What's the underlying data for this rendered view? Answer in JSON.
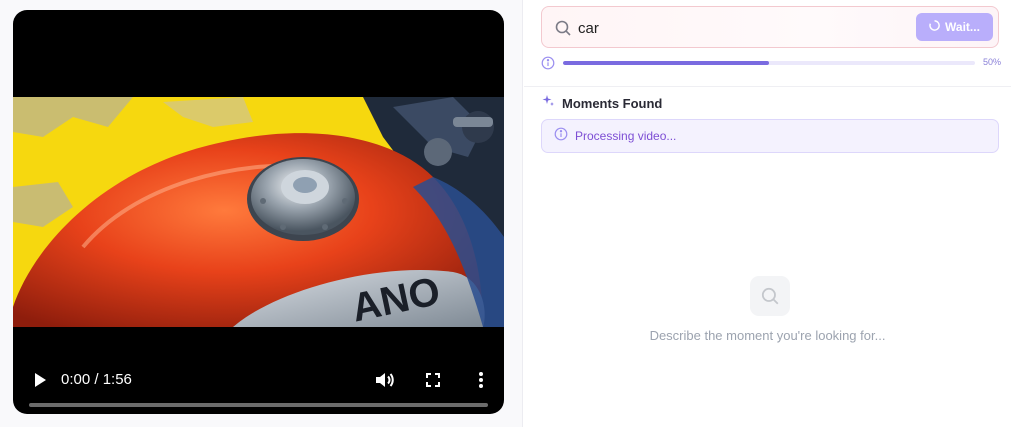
{
  "player": {
    "time_display": "0:00 / 1:56",
    "progress_fraction": 0
  },
  "search": {
    "value": "car",
    "button_label": "Wait..."
  },
  "processing": {
    "percent_label": "50%",
    "fraction": 0.5
  },
  "moments": {
    "title": "Moments Found",
    "status_text": "Processing video...",
    "empty_text": "Describe the moment you're looking for..."
  },
  "icons": {
    "search": "search-icon",
    "spinner": "spinner-icon",
    "sparkle": "sparkle-icon",
    "info": "info-icon",
    "play": "play-icon",
    "volume": "volume-icon",
    "fullscreen": "fullscreen-icon",
    "more": "more-vertical-icon"
  },
  "colors": {
    "accent": "#7a6be0",
    "button_bg": "#b9aefb",
    "status_text": "#7d4ed4"
  }
}
